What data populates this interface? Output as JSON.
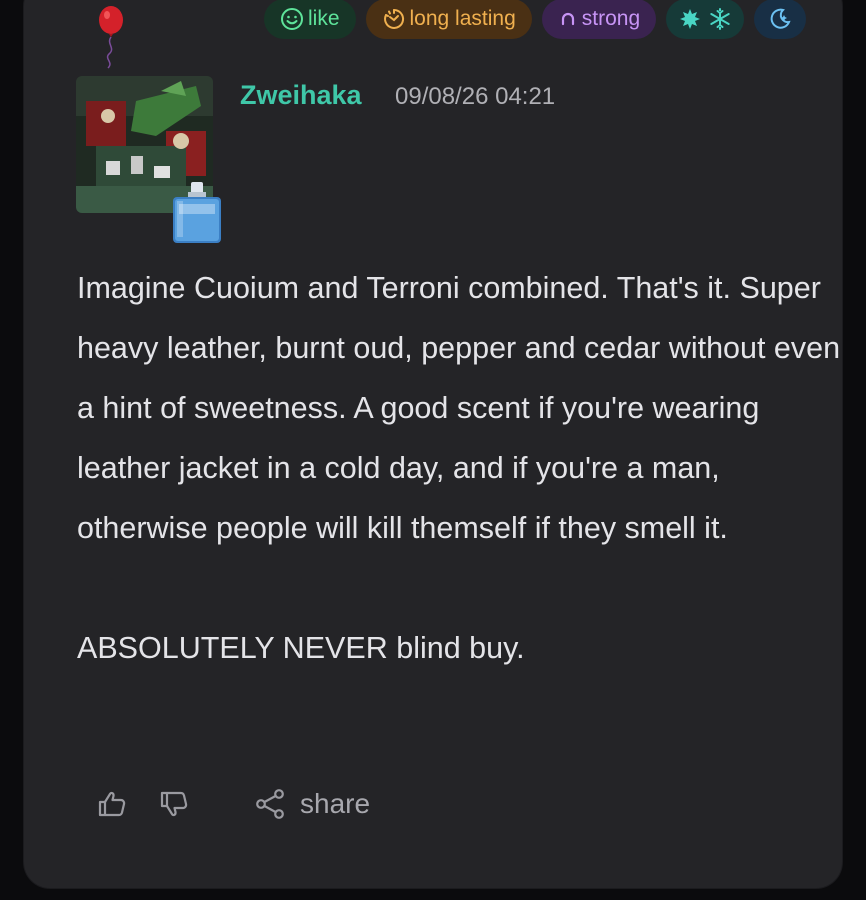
{
  "badges": [
    {
      "label": "like",
      "icon": "smiley-icon",
      "color": "#5ee39a"
    },
    {
      "label": "long lasting",
      "icon": "timer-icon",
      "color": "#f0b04f"
    },
    {
      "label": "strong",
      "icon": "gauge-icon",
      "color": "#c794f5"
    },
    {
      "label": "",
      "icon": "leaf-snowflake-icon",
      "color": "#49d6c4"
    },
    {
      "label": "",
      "icon": "moon-icon",
      "color": "#6cc1f2"
    }
  ],
  "review": {
    "username": "Zweihaka",
    "timestamp": "09/08/26 04:21",
    "body_line_1": "Imagine Cuoium and Terroni combined. That's it. Super heavy leather, burnt oud, pepper and cedar without even a hint of sweetness. A good scent if you're wearing leather jacket in a cold day, and if you're a man, otherwise people will kill themself if they smell it.",
    "body_line_2": "ABSOLUTELY NEVER blind buy."
  },
  "actions": {
    "share_label": "share"
  },
  "colors": {
    "card_bg": "#242427",
    "username": "#3fc7a8",
    "text": "#e4e4e8"
  }
}
